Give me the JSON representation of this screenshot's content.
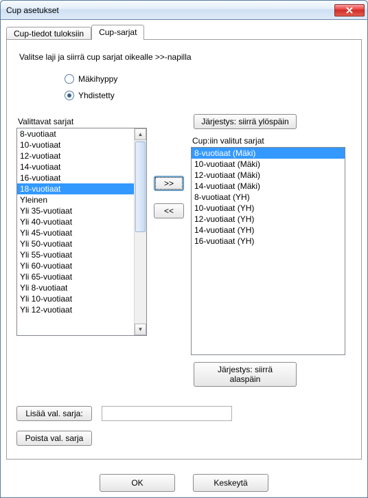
{
  "window": {
    "title": "Cup asetukset"
  },
  "tabs": {
    "t0": "Cup-tiedot tuloksiin",
    "t1": "Cup-sarjat",
    "active": 1
  },
  "instruction": "Valitse laji ja siirrä cup sarjat oikealle >>-napilla",
  "radios": {
    "r0": "Mäkihyppy",
    "r1": "Yhdistetty",
    "selected": 1
  },
  "labels": {
    "available": "Valittavat sarjat",
    "chosen": "Cup:iin valitut sarjat"
  },
  "buttons": {
    "order_up": "Järjestys: siirrä ylöspäin",
    "order_down": "Järjestys: siirrä alaspäin",
    "move_right": ">>",
    "move_left": "<<",
    "add_sel": "Lisää val. sarja:",
    "del_sel": "Poista val. sarja",
    "ok": "OK",
    "cancel": "Keskeytä"
  },
  "available_list": [
    "8-vuotiaat",
    "10-vuotiaat",
    "12-vuotiaat",
    "14-vuotiaat",
    "16-vuotiaat",
    "18-vuotiaat",
    "Yleinen",
    "Yli 35-vuotiaat",
    "Yli 40-vuotiaat",
    "Yli 45-vuotiaat",
    "Yli 50-vuotiaat",
    "Yli 55-vuotiaat",
    "Yli 60-vuotiaat",
    "Yli 65-vuotiaat",
    "Yli 8-vuotiaat",
    "Yli 10-vuotiaat",
    "Yli 12-vuotiaat"
  ],
  "available_selected_index": 5,
  "chosen_list": [
    "8-vuotiaat (Mäki)",
    "10-vuotiaat (Mäki)",
    "12-vuotiaat (Mäki)",
    "14-vuotiaat (Mäki)",
    "8-vuotiaat (YH)",
    "10-vuotiaat (YH)",
    "12-vuotiaat (YH)",
    "14-vuotiaat (YH)",
    "16-vuotiaat (YH)"
  ],
  "chosen_selected_index": 0,
  "add_input_value": ""
}
